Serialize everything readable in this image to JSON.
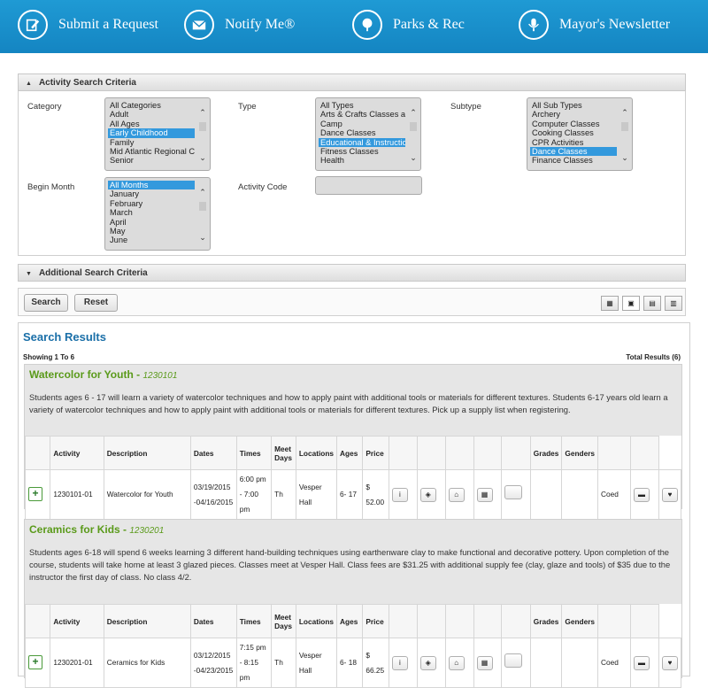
{
  "nav": [
    {
      "label": "Submit a Request",
      "icon": "edit-icon"
    },
    {
      "label": "Notify Me®",
      "icon": "envelope-icon"
    },
    {
      "label": "Parks & Rec",
      "icon": "tree-icon"
    },
    {
      "label": "Mayor's Newsletter",
      "icon": "microphone-icon"
    }
  ],
  "criteria": {
    "title": "Activity Search Criteria",
    "category_label": "Category",
    "category_options": [
      "All Categories",
      "Adult",
      "All Ages",
      "Early Childhood",
      "Family",
      "Mid Atlantic Regional Co",
      "Senior"
    ],
    "category_selected": "Early Childhood",
    "type_label": "Type",
    "type_options": [
      "All Types",
      "Arts & Crafts Classes at",
      "Camp",
      "Dance Classes",
      "Educational & Instruction",
      "Fitness Classes",
      "Health"
    ],
    "type_selected": "Educational & Instruction",
    "subtype_label": "Subtype",
    "subtype_options": [
      "All Sub Types",
      "Archery",
      "Computer Classes",
      "Cooking Classes",
      "CPR Activities",
      "Dance Classes",
      "Finance Classes"
    ],
    "subtype_selected": "Dance Classes",
    "month_label": "Begin Month",
    "month_options": [
      "All Months",
      "January",
      "February",
      "March",
      "April",
      "May",
      "June"
    ],
    "month_selected": "All Months",
    "code_label": "Activity Code",
    "code_value": ""
  },
  "additional": {
    "title": "Additional Search Criteria"
  },
  "toolbar": {
    "search": "Search",
    "reset": "Reset",
    "views": [
      "▦",
      "▣",
      "▤",
      "▥"
    ]
  },
  "results": {
    "title": "Search Results",
    "showing": "Showing 1 To 6",
    "total": "Total Results (6)",
    "headers": [
      "Activity",
      "Description",
      "Dates",
      "Times",
      "Meet Days",
      "Locations",
      "Ages",
      "Price",
      "Grades",
      "Genders"
    ],
    "items": [
      {
        "name": "Watercolor for Youth",
        "code": "1230101",
        "desc": "Students ages 6 - 17 will learn a variety of watercolor techniques and how to apply paint with additional tools or materials for different textures. Students 6-17 years old learn a variety of watercolor techniques and how to apply paint with additional tools or materials for different textures. Pick up a supply list when registering.",
        "row": {
          "activity": "1230101-01",
          "description": "Watercolor for Youth",
          "dates": "03/19/2015 -04/16/2015",
          "times": "6:00 pm - 7:00 pm",
          "days": "Th",
          "location": "Vesper Hall",
          "ages": "6- 17",
          "price": "$ 52.00",
          "grades": "",
          "gender": "Coed"
        }
      },
      {
        "name": "Ceramics for Kids",
        "code": "1230201",
        "desc": "Students ages 6-18 will spend 6 weeks learning 3 different hand-building techniques using earthenware clay to make functional and decorative pottery. Upon completion of the course, students will take home at least 3 glazed pieces. Classes meet at Vesper Hall. Class fees are $31.25 with additional supply fee (clay, glaze and tools) of $35 due to the instructor the first day of class. No class 4/2.",
        "row": {
          "activity": "1230201-01",
          "description": "Ceramics for Kids",
          "dates": "03/12/2015 -04/23/2015",
          "times": "7:15 pm - 8:15 pm",
          "days": "Th",
          "location": "Vesper Hall",
          "ages": "6- 18",
          "price": "$ 66.25",
          "grades": "",
          "gender": "Coed"
        }
      }
    ]
  }
}
